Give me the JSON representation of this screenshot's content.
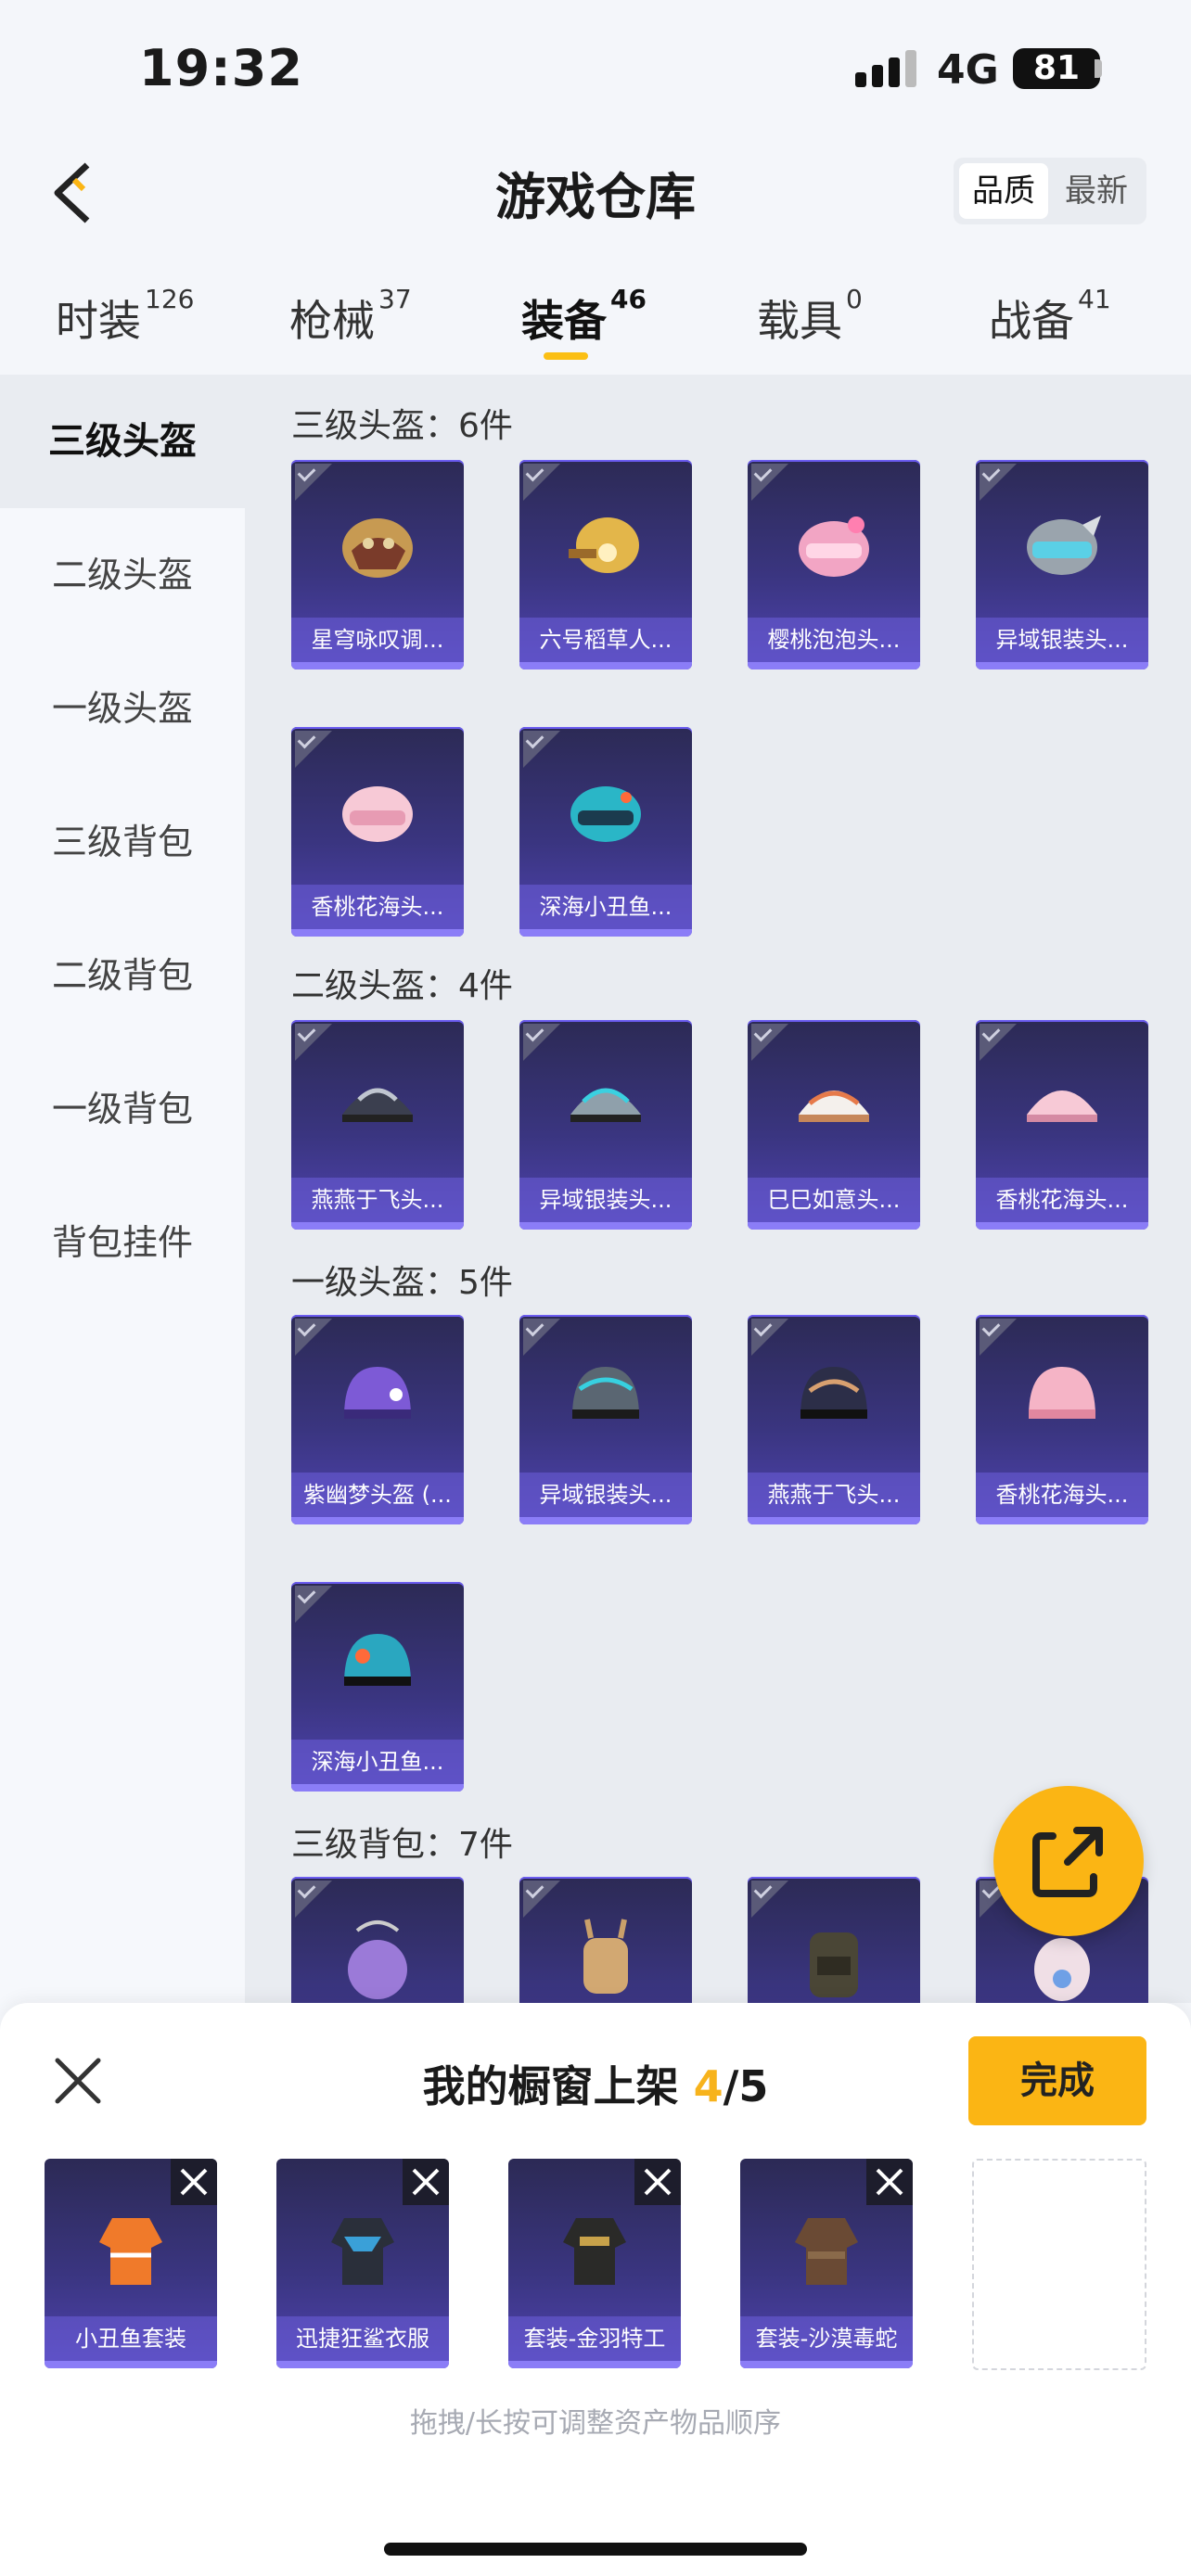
{
  "status_bar": {
    "time": "19:32",
    "network": "4G",
    "battery": "81"
  },
  "header": {
    "title": "游戏仓库",
    "sort_options": [
      "品质",
      "最新"
    ]
  },
  "tabs": [
    {
      "label": "时装",
      "count": "126"
    },
    {
      "label": "枪械",
      "count": "37"
    },
    {
      "label": "装备",
      "count": "46",
      "active": true
    },
    {
      "label": "载具",
      "count": "0"
    },
    {
      "label": "战备",
      "count": "41"
    }
  ],
  "sidebar": {
    "items": [
      "三级头盔",
      "二级头盔",
      "一级头盔",
      "三级背包",
      "二级背包",
      "一级背包",
      "背包挂件"
    ],
    "active_index": 0
  },
  "sections": [
    {
      "title": "三级头盔：6件",
      "items": [
        "星穹咏叹调...",
        "六号稻草人...",
        "樱桃泡泡头...",
        "异域银装头...",
        "香桃花海头...",
        "深海小丑鱼..."
      ]
    },
    {
      "title": "二级头盔：4件",
      "items": [
        "燕燕于飞头...",
        "异域银装头...",
        "巳巳如意头...",
        "香桃花海头..."
      ]
    },
    {
      "title": "一级头盔：5件",
      "items": [
        "紫幽梦头盔 (...",
        "异域银装头...",
        "燕燕于飞头...",
        "香桃花海头...",
        "深海小丑鱼..."
      ]
    },
    {
      "title": "三级背包：7件",
      "items": [
        "",
        "",
        "",
        ""
      ]
    }
  ],
  "showcase": {
    "title_prefix": "我的橱窗上架 ",
    "count": "4",
    "total": "/5",
    "done_label": "完成",
    "items": [
      "小丑鱼套装",
      "迅捷狂鲨衣服",
      "套装-金羽特工",
      "套装-沙漠毒蛇"
    ],
    "hint": "拖拽/长按可调整资产物品顺序"
  },
  "colors": {
    "accent": "#fbb514",
    "card": "#3a3580"
  }
}
